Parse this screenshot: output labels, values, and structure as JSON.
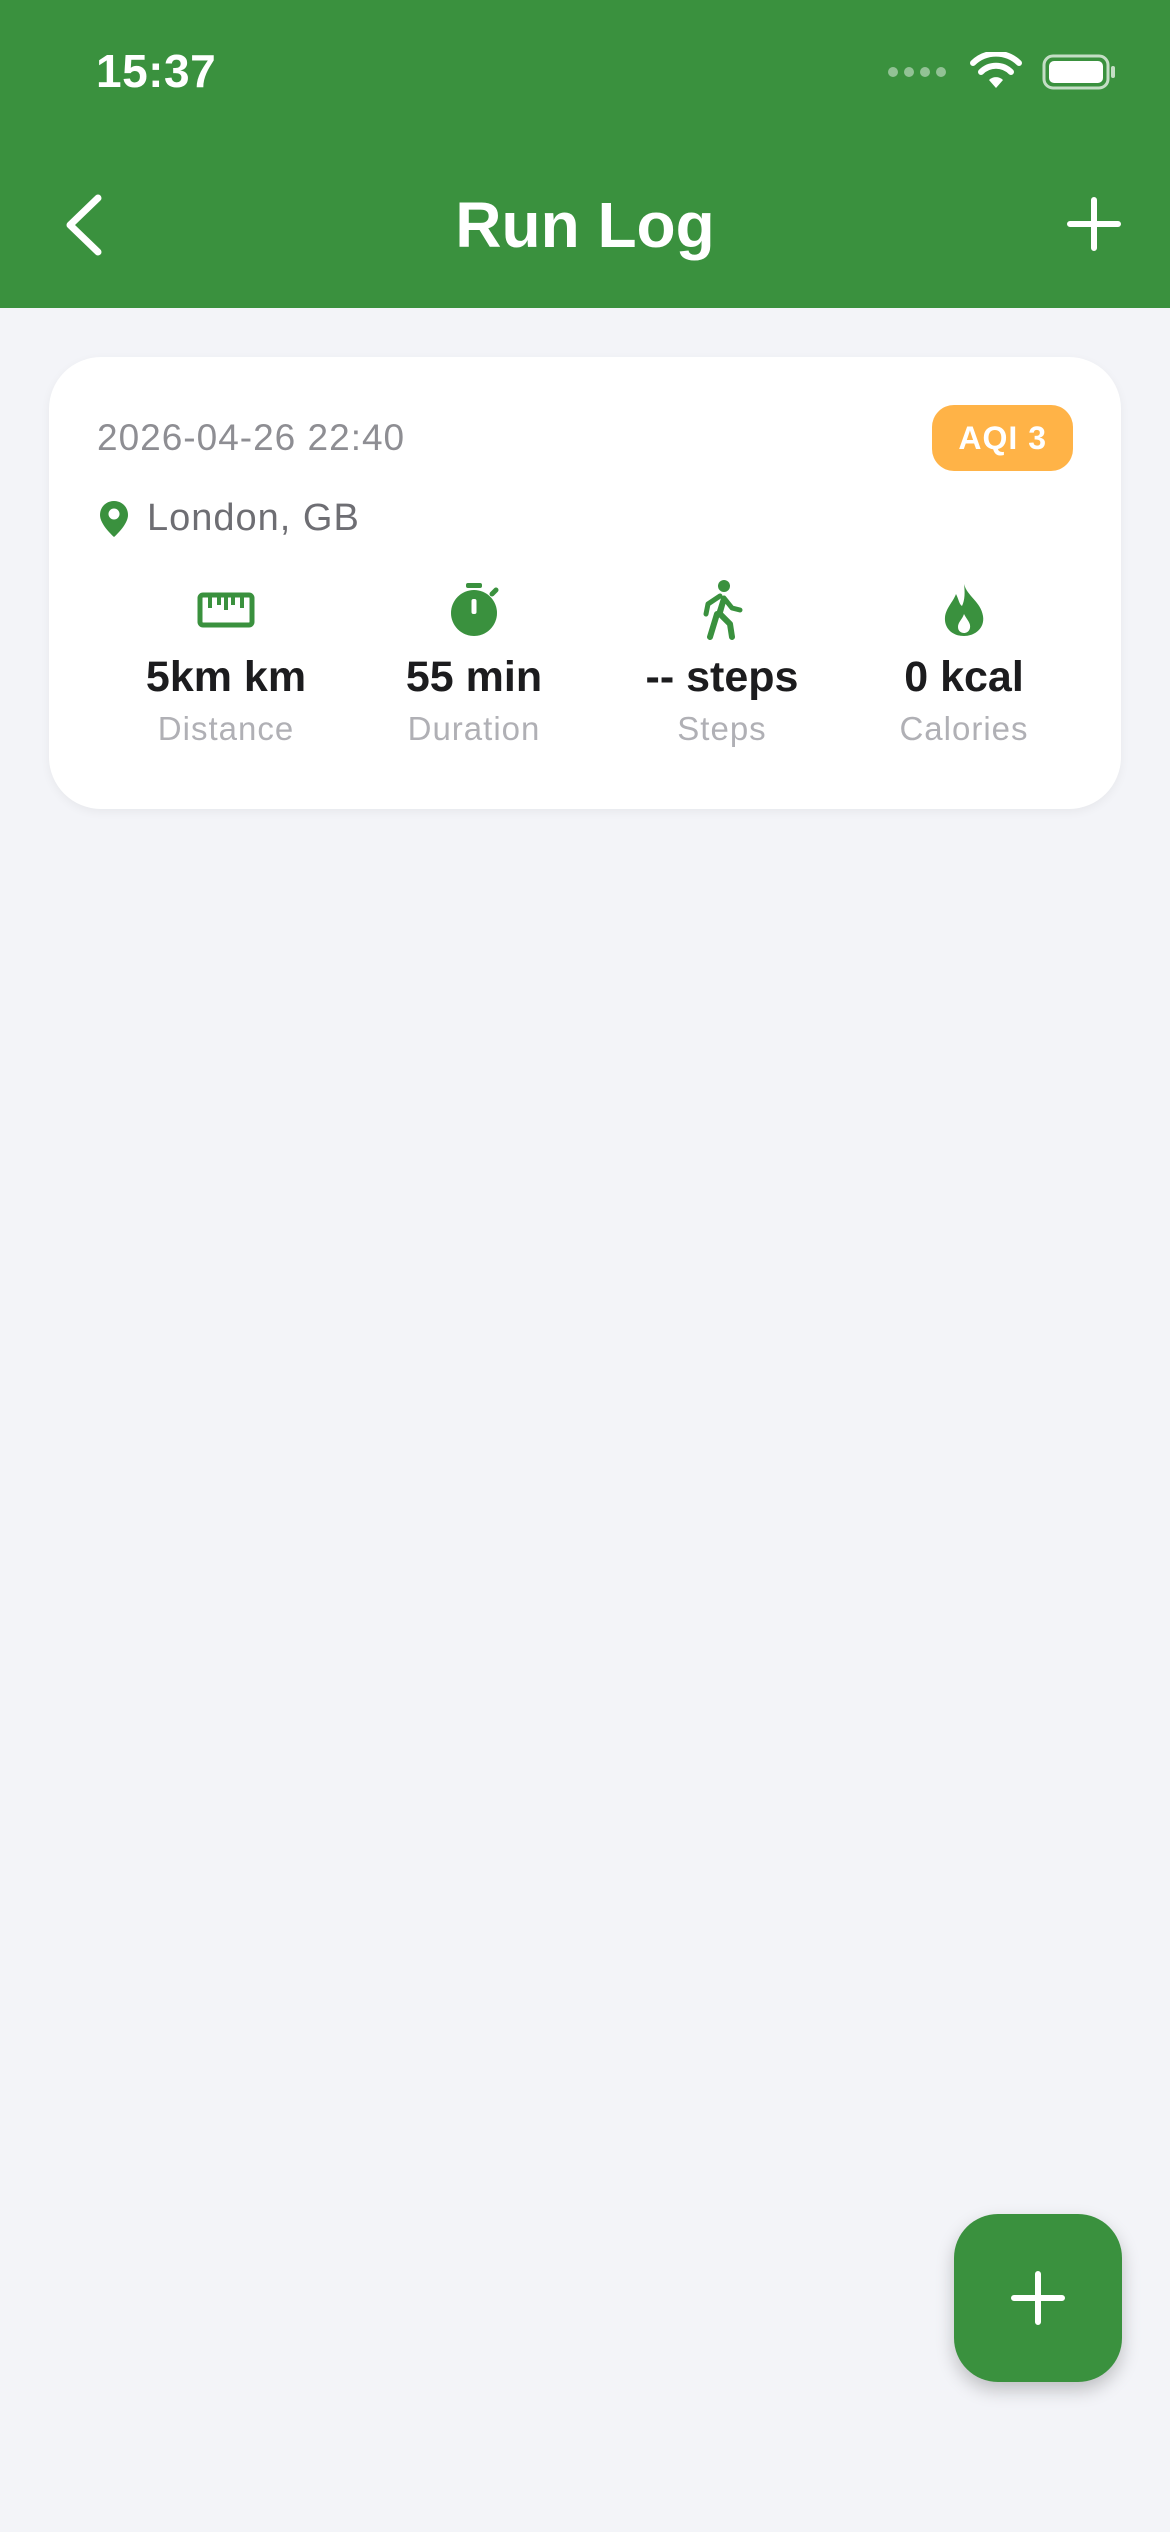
{
  "status_bar": {
    "time": "15:37"
  },
  "nav": {
    "title": "Run Log",
    "back_icon": "chevron-left-icon",
    "add_icon": "plus-icon"
  },
  "run_entries": [
    {
      "datetime": "2026-04-26 22:40",
      "aqi_badge": "AQI 3",
      "location": "London, GB",
      "stats": [
        {
          "icon": "ruler-icon",
          "value": "5km km",
          "label": "Distance"
        },
        {
          "icon": "stopwatch-icon",
          "value": "55 min",
          "label": "Duration"
        },
        {
          "icon": "walking-icon",
          "value": "-- steps",
          "label": "Steps"
        },
        {
          "icon": "flame-icon",
          "value": "0 kcal",
          "label": "Calories"
        }
      ]
    }
  ],
  "fab": {
    "icon": "plus-icon"
  },
  "colors": {
    "brand_green": "#3a913e",
    "aqi_orange": "#ffb347",
    "background": "#f3f4f8"
  }
}
